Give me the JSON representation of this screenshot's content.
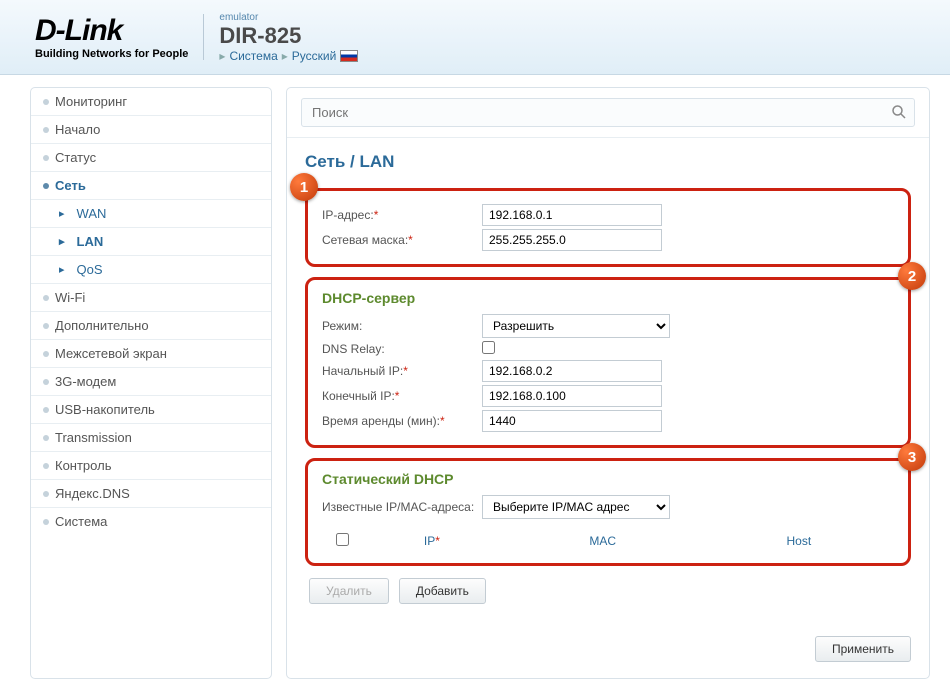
{
  "header": {
    "brand": "D-Link",
    "tagline": "Building Networks for People",
    "emulator": "emulator",
    "model": "DIR-825",
    "bc_system": "Система",
    "bc_lang": "Русский"
  },
  "sidebar": {
    "items": [
      "Мониторинг",
      "Начало",
      "Статус",
      "Сеть"
    ],
    "sub": [
      "WAN",
      "LAN",
      "QoS"
    ],
    "items2": [
      "Wi-Fi",
      "Дополнительно",
      "Межсетевой экран",
      "3G-модем",
      "USB-накопитель",
      "Transmission",
      "Контроль",
      "Яндекс.DNS",
      "Система"
    ]
  },
  "search": {
    "placeholder": "Поиск"
  },
  "page": {
    "title": "Сеть /  LAN"
  },
  "basic": {
    "ip_label": "IP-адрес:",
    "ip_value": "192.168.0.1",
    "mask_label": "Сетевая маска:",
    "mask_value": "255.255.255.0"
  },
  "dhcp": {
    "title": "DHCP-сервер",
    "mode_label": "Режим:",
    "mode_value": "Разрешить",
    "relay_label": "DNS Relay:",
    "start_label": "Начальный IP:",
    "start_value": "192.168.0.2",
    "end_label": "Конечный IP:",
    "end_value": "192.168.0.100",
    "lease_label": "Время аренды (мин):",
    "lease_value": "1440"
  },
  "static": {
    "title": "Статический DHCP",
    "known_label": "Известные IP/MAC-адреса:",
    "select_value": "Выберите IP/MAC адрес",
    "col_ip": "IP",
    "col_mac": "MAC",
    "col_host": "Host"
  },
  "buttons": {
    "delete": "Удалить",
    "add": "Добавить",
    "apply": "Применить"
  },
  "markers": {
    "m1": "1",
    "m2": "2",
    "m3": "3"
  }
}
